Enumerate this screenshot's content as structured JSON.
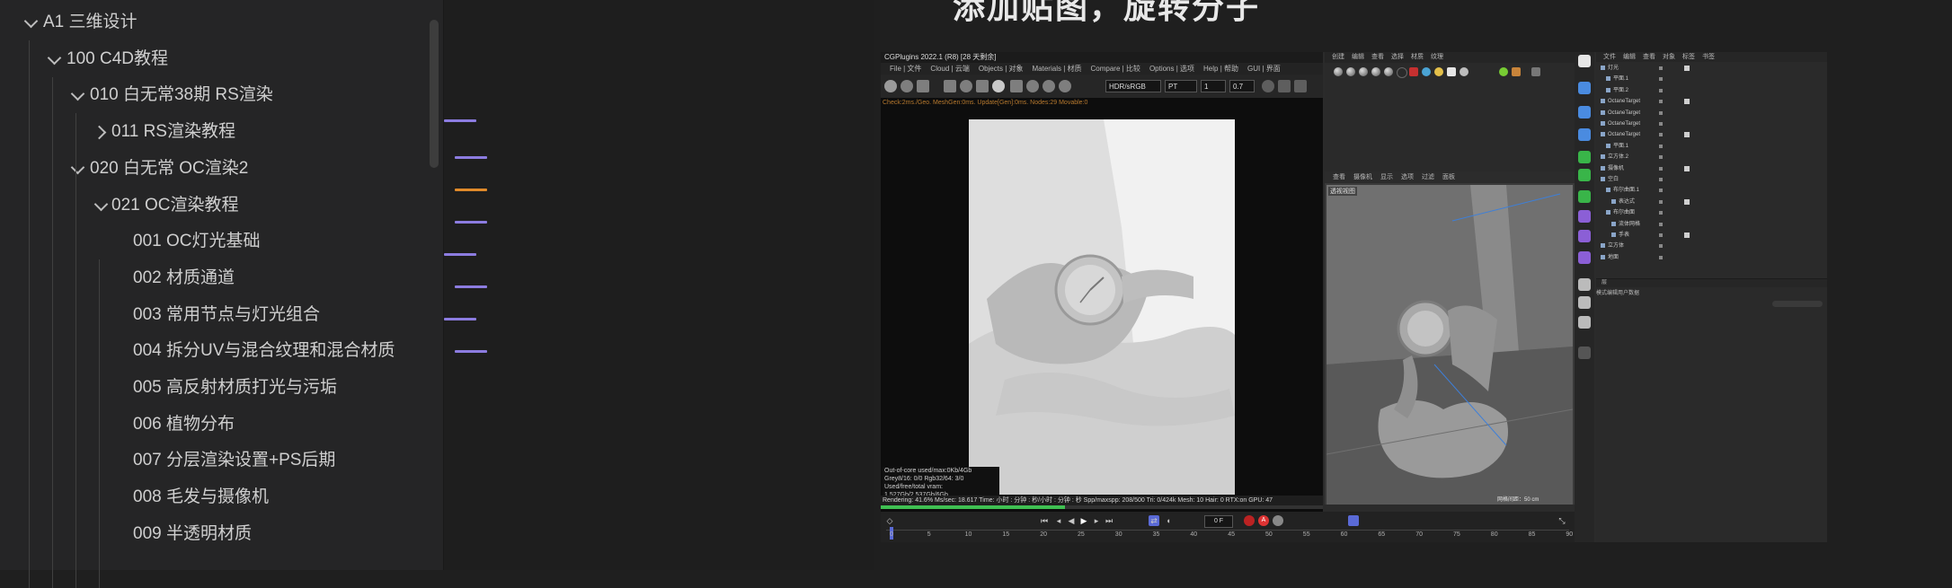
{
  "header": {
    "title": "添加贴图，旋转分子"
  },
  "tree": {
    "items": [
      {
        "label": "A1  三维设计",
        "level": 0,
        "state": "expanded"
      },
      {
        "label": "100  C4D教程",
        "level": 1,
        "state": "expanded"
      },
      {
        "label": "010  白无常38期 RS渲染",
        "level": 2,
        "state": "expanded"
      },
      {
        "label": "011  RS渲染教程",
        "level": 3,
        "state": "collapsed"
      },
      {
        "label": "020 白无常 OC渲染2",
        "level": 2,
        "state": "expanded"
      },
      {
        "label": "021 OC渲染教程",
        "level": 3,
        "state": "expanded"
      },
      {
        "label": "001 OC灯光基础",
        "level": 4,
        "state": "leaf"
      },
      {
        "label": "002 材质通道",
        "level": 4,
        "state": "leaf"
      },
      {
        "label": "003 常用节点与灯光组合",
        "level": 4,
        "state": "leaf"
      },
      {
        "label": "004 拆分UV与混合纹理和混合材质",
        "level": 4,
        "state": "leaf"
      },
      {
        "label": "005 高反射材质打光与污垢",
        "level": 4,
        "state": "leaf"
      },
      {
        "label": "006 植物分布",
        "level": 4,
        "state": "leaf"
      },
      {
        "label": "007 分层渲染设置+PS后期",
        "level": 4,
        "state": "leaf"
      },
      {
        "label": "008 毛发与摄像机",
        "level": 4,
        "state": "leaf"
      },
      {
        "label": "009 半透明材质",
        "level": 4,
        "state": "leaf"
      }
    ]
  },
  "marker_colors": [
    "#8c7ce0",
    "#8c7ce0",
    "#e08a2a",
    "#8c7ce0",
    "#8c7ce0",
    "#8c7ce0",
    "#8c7ce0",
    "#8c7ce0"
  ],
  "c4d": {
    "renderview": {
      "title": "CGPlugins    2022.1 (R8) [28 天剩余]",
      "menus": [
        "File | 文件",
        "Cloud | 云端",
        "Objects | 对象",
        "Materials | 材质",
        "Compare | 比较",
        "Options | 选项",
        "Help | 帮助",
        "GUI | 界面"
      ],
      "color_space": "HDR/sRGB",
      "pass": "PT",
      "value_a": "1",
      "value_b": "0.7",
      "status": "Check:2ms./Geo. MeshGen:0ms. Update[Gen]:0ms. Nodes:29 Movable:0",
      "info": [
        "Out-of-core used/max:0Kb/4Gb",
        "Grey8/16: 0/0        Rgb32/64: 3/0",
        "Used/free/total vram: 1.527Gb/2.537Gb/6Gb"
      ],
      "bottom": "Rendering: 41.6%    Ms/sec: 18.617    Time: 小时 : 分钟 : 秒/小时 : 分钟 : 秒    Spp/maxspp: 208/500    Tri: 0/424k    Mesh: 10    Hair: 0    RTX:on    GPU: 47",
      "progress": 0.416
    },
    "material_menu": [
      "创建",
      "编辑",
      "查看",
      "选择",
      "材质",
      "纹理"
    ],
    "viewport_menu": [
      "查看",
      "摄像机",
      "显示",
      "选项",
      "过滤",
      "面板"
    ],
    "viewport_label": "透视视图",
    "viewport_grid": "网格间距：50 cm",
    "object_menu": [
      "文件",
      "编辑",
      "查看",
      "对象",
      "标签",
      "书签"
    ],
    "objects": [
      "灯光",
      "平面.1",
      "平面.2",
      "OctaneTarget",
      "OctaneTarget",
      "OctaneTarget",
      "OctaneTarget",
      "平面.1",
      "立方体.2",
      "摄像机",
      "空白",
      "布尔曲面.1",
      "表达式",
      "布尔曲面",
      "流体网格",
      "手表",
      "立方体",
      "地面"
    ],
    "attr_menu": [
      "模式",
      "编辑",
      "用户数据"
    ],
    "attr_tab": "层",
    "timeline": {
      "frame": "0 F",
      "ticks": [
        "0",
        "5",
        "10",
        "15",
        "20",
        "25",
        "30",
        "35",
        "40",
        "45",
        "50",
        "55",
        "60",
        "65",
        "70",
        "75",
        "80",
        "85",
        "90"
      ]
    }
  }
}
